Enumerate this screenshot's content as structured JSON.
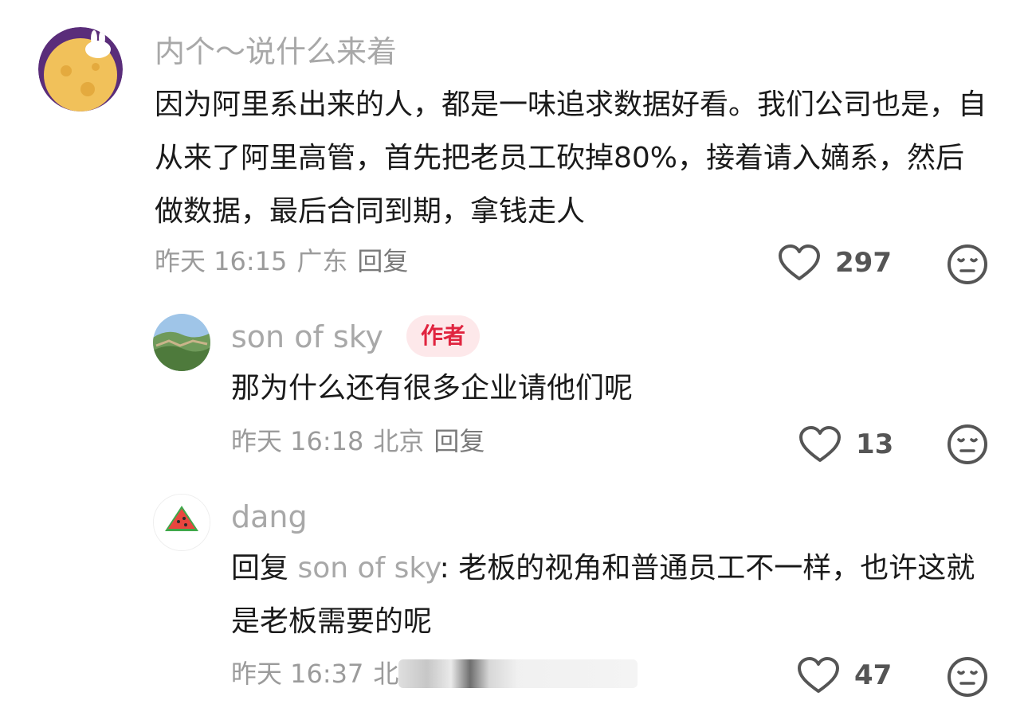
{
  "comments": [
    {
      "username": "内个～说什么来着",
      "text": "因为阿里系出来的人，都是一味追求数据好看。我们公司也是，自从来了阿里高管，首先把老员工砍掉80%，接着请入嫡系，然后做数据，最后合同到期，拿钱走人",
      "time": "昨天 16:15",
      "location": "广东",
      "reply_label": "回复",
      "likes": "297",
      "avatar_icon": "moon-rabbit-avatar"
    },
    {
      "username": "son of sky",
      "badge": "作者",
      "text": "那为什么还有很多企业请他们呢",
      "time": "昨天 16:18",
      "location": "北京",
      "reply_label": "回复",
      "likes": "13",
      "avatar_icon": "great-wall-avatar"
    },
    {
      "username": "dang",
      "reply_prefix": "回复",
      "reply_to": "son of sky",
      "text": ": 老板的视角和普通员工不一样，也许这就是老板需要的呢",
      "time": "昨天 16:37",
      "location": "北",
      "likes": "47",
      "avatar_icon": "watermelon-avatar"
    }
  ],
  "colors": {
    "badge_bg": "#fde8ea",
    "badge_text": "#e0243f",
    "username": "#a8a8a8",
    "meta": "#9b9b9b",
    "icon_stroke": "#555555"
  }
}
